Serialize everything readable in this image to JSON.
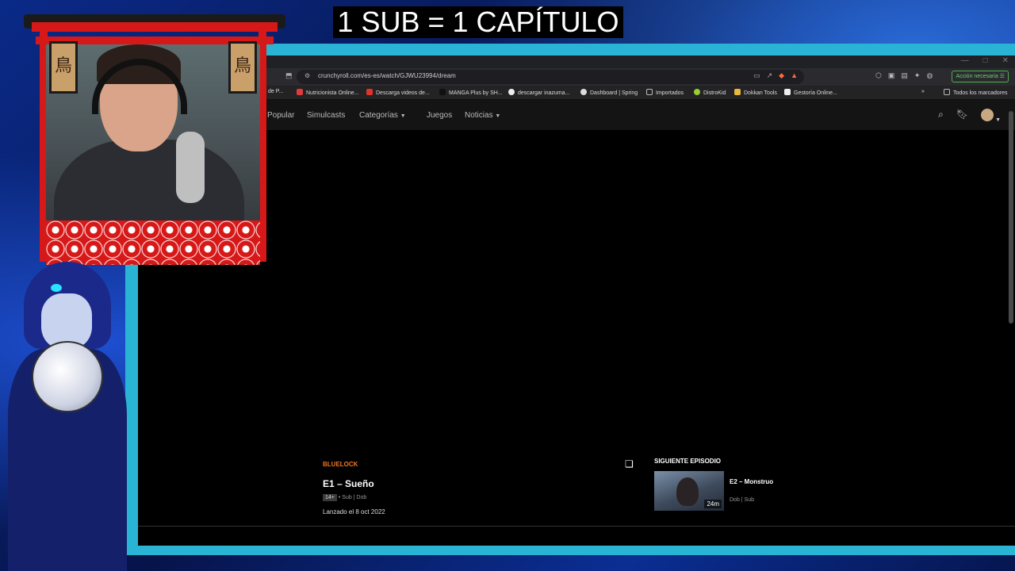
{
  "overlay": {
    "title": "1 SUB = 1 CAPÍTULO"
  },
  "browser": {
    "url": "crunchyroll.com/es-es/watch/GJWU23994/dream",
    "accion_label": "Acción necesaria",
    "bookmarks": [
      "de P...",
      "Nutricionista Online...",
      "Descarga videos de...",
      "MANGA Plus by SH...",
      "descargar inazuma...",
      "Dashboard | Spring",
      "Importados",
      "DistroKid",
      "Dokkan Tools",
      "Gestoría Online..."
    ],
    "all_bookmarks": "Todos los marcadores"
  },
  "site": {
    "nav": [
      "Popular",
      "Simulcasts",
      "Categorías",
      "Juegos",
      "Noticias"
    ]
  },
  "episode": {
    "series": "BLUELOCK",
    "title": "E1 – Sueño",
    "rating": "14+",
    "langs": "• Sub | Dob",
    "released": "Lanzado el 8 oct 2022"
  },
  "next": {
    "label": "SIGUIENTE EPISODIO",
    "title": "E2 – Monstruo",
    "duration": "24m",
    "meta": "Dob | Sub"
  },
  "webcam": {
    "lantern_char": "鳥"
  },
  "colors": {
    "accent": "#f47521",
    "frame": "#29b4d6",
    "torii": "#d71818"
  }
}
